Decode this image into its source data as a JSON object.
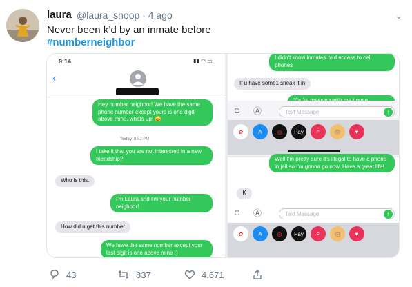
{
  "tweet": {
    "author_name": "laura",
    "author_handle": "@laura_shoop · 4 ago",
    "text": "Never been k’d by an inmate before",
    "hashtag": "#numberneighbor",
    "actions": {
      "replies": "43",
      "retweets": "837",
      "likes": "4.671"
    }
  },
  "left_screen": {
    "status_time": "9:14",
    "messages_top": "Hey number neighbor! We have the same phone number except yours is one digit above mine, whats up! 😀",
    "timestamp_day": "Today",
    "timestamp_time": "8:52 PM",
    "msgs": [
      "I take it that you are not interested in a new friendship?",
      "Who is this.",
      "I'm Laura and I'm your number neighbor!",
      "How did u get this number",
      "We have the same number except your last digit is one above mine :)"
    ]
  },
  "right_top": {
    "msg1": "I didn't know inmates had access to cell phones",
    "msg2": "If u have some1 sneak it in",
    "msg3": "You're messing with me homie",
    "placeholder": "Text Message"
  },
  "right_bottom": {
    "msg1": "Well I'm pretty sure it's illegal to have a phone in jail so I'm gonna go now. Have a great life!",
    "msg2": "K",
    "placeholder": "Text Message"
  },
  "apps": [
    "Photos",
    "App Store",
    "Activity",
    "Apple Pay",
    "Search",
    "Monkey",
    "Heart"
  ],
  "colors": {
    "imessage_green": "#34c759",
    "link": "#1b95e0"
  }
}
